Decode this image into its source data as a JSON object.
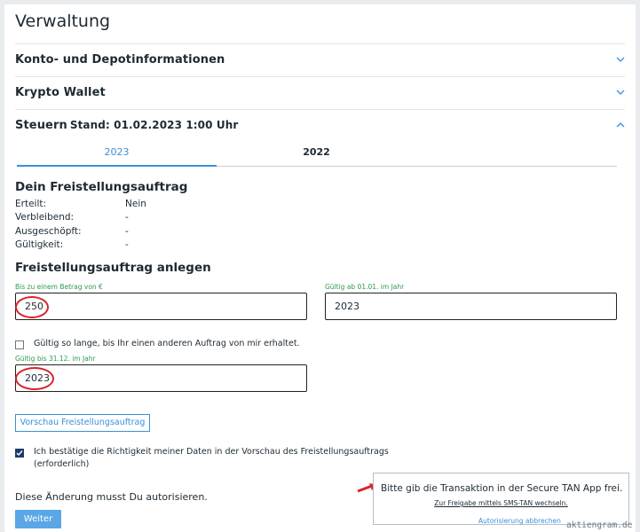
{
  "page": {
    "title": "Verwaltung"
  },
  "accordion": [
    {
      "label": "Konto- und Depotinformationen",
      "state": "collapsed"
    },
    {
      "label": "Krypto Wallet",
      "state": "collapsed"
    },
    {
      "label": "Steuern",
      "sub": "Stand: 01.02.2023 1:00 Uhr",
      "state": "expanded"
    }
  ],
  "tabs": [
    {
      "label": "2023",
      "active": true
    },
    {
      "label": "2022",
      "active": false
    }
  ],
  "freistellung": {
    "heading": "Dein Freistellungsauftrag",
    "rows": [
      {
        "key": "Erteilt:",
        "value": "Nein"
      },
      {
        "key": "Verbleibend:",
        "value": "-"
      },
      {
        "key": "Ausgeschöpft:",
        "value": "-"
      },
      {
        "key": "Gültigkeit:",
        "value": "-"
      }
    ]
  },
  "form": {
    "heading": "Freistellungsauftrag anlegen",
    "amount_label": "Bis zu einem Betrag von €",
    "amount_value": "250",
    "from_label": "Gültig ab 01.01. im Jahr",
    "from_value": "2023",
    "checkbox_until_text": "Gültig so lange, bis Ihr einen anderen Auftrag von mir erhaltet.",
    "checkbox_until_checked": false,
    "until_label": "Gültig bis 31.12. im Jahr",
    "until_value": "2023",
    "preview_button": "Vorschau Freistellungsauftrag",
    "confirm_text_1": "Ich bestätige die Richtigkeit meiner Daten in der Vorschau des Freistellungsauftrags",
    "confirm_text_2": "(erforderlich)",
    "confirm_checked": true,
    "authorize_text": "Diese Änderung musst Du autorisieren.",
    "continue_button": "Weiter"
  },
  "tan": {
    "title": "Bitte gib die Transaktion in der Secure TAN App frei.",
    "sms_link": "Zur Freigabe mittels SMS-TAN wechseln.",
    "cancel_link": "Autorisierung abbrechen"
  },
  "watermark": "aktiengram.de",
  "colors": {
    "accent": "#3a8fd8",
    "annotation_red": "#d8242a",
    "label_green": "#2e9a4b",
    "checkbox_navy": "#1d3a6b"
  },
  "icons": {
    "collapsed": "chevron-down-icon",
    "expanded": "chevron-up-icon",
    "checked": "checkmark-icon"
  }
}
